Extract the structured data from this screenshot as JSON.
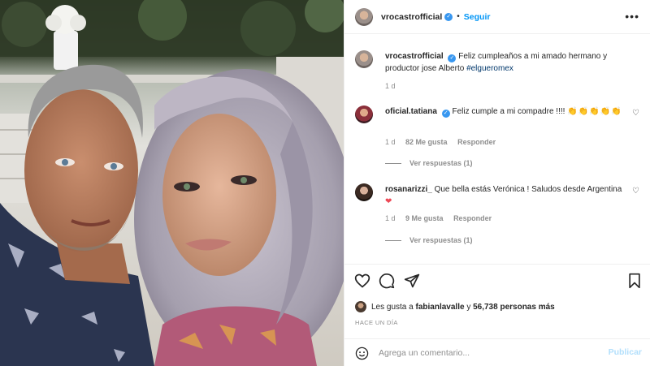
{
  "post": {
    "author": "vrocastrofficial",
    "follow_label": "Seguir",
    "more_icon": "more-options-icon"
  },
  "caption": {
    "username": "vrocastrofficial",
    "text": "Feliz cumpleaños a mi amado hermano y productor jose Alberto ",
    "hashtag": "#elgueromex",
    "time": "1 d"
  },
  "comments": [
    {
      "username": "oficial.tatiana",
      "text": "Feliz cumple a mi compadre !!!! ",
      "emoji": "👏👏👏👏👏",
      "time": "1 d",
      "likes": "82 Me gusta",
      "reply_label": "Responder",
      "view_replies": "Ver respuestas (1)"
    },
    {
      "username": "rosanarizzi_",
      "text": "Que bella estás Verónica ! Saludos desde Argentina ",
      "emoji": "❤",
      "time": "1 d",
      "likes": "9 Me gusta",
      "reply_label": "Responder",
      "view_replies": "Ver respuestas (1)"
    }
  ],
  "likes_summary": {
    "prefix": "Les gusta a ",
    "user": "fabianlavalle",
    "middle": " y ",
    "count": "56,738 personas más"
  },
  "timestamp": "HACE UN DÍA",
  "comment_box": {
    "placeholder": "Agrega un comentario...",
    "publish_label": "Publicar"
  },
  "colors": {
    "accent": "#0095f6",
    "publish_disabled": "#b2dffc",
    "verified": "#3897f0",
    "heart": "#ed4956"
  }
}
